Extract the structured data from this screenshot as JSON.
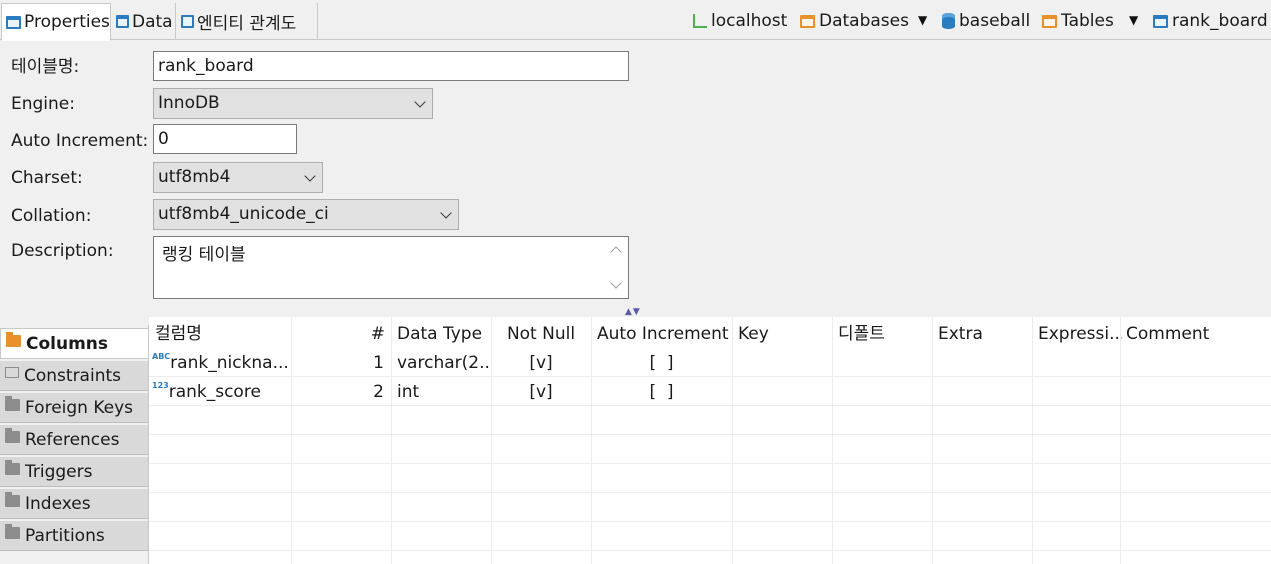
{
  "tabs": [
    {
      "label": "Properties"
    },
    {
      "label": "Data"
    },
    {
      "label": "엔티티 관계도"
    }
  ],
  "breadcrumb": {
    "host": "localhost",
    "databases": "Databases",
    "schema": "baseball",
    "tables": "Tables",
    "table": "rank_board"
  },
  "form": {
    "table_name_label": "테이블명:",
    "table_name_value": "rank_board",
    "engine_label": "Engine:",
    "engine_value": "InnoDB",
    "auto_increment_label": "Auto Increment:",
    "auto_increment_value": "0",
    "charset_label": "Charset:",
    "charset_value": "utf8mb4",
    "collation_label": "Collation:",
    "collation_value": "utf8mb4_unicode_ci",
    "description_label": "Description:",
    "description_value": "랭킹 테이블"
  },
  "sidebar": {
    "items": [
      {
        "label": "Columns"
      },
      {
        "label": "Constraints"
      },
      {
        "label": "Foreign Keys"
      },
      {
        "label": "References"
      },
      {
        "label": "Triggers"
      },
      {
        "label": "Indexes"
      },
      {
        "label": "Partitions"
      }
    ]
  },
  "table": {
    "headers": [
      "컬럼명",
      "#",
      "Data Type",
      "Not Null",
      "Auto Increment",
      "Key",
      "디폴트",
      "Extra",
      "Expressi...",
      "Comment"
    ],
    "rows": [
      {
        "type_icon": "ABC",
        "name": "rank_nickna...",
        "num": "1",
        "data_type": "varchar(2...",
        "not_null": "[v]",
        "auto_increment": "[  ]"
      },
      {
        "type_icon": "123",
        "name": "rank_score",
        "num": "2",
        "data_type": "int",
        "not_null": "[v]",
        "auto_increment": "[  ]"
      }
    ]
  },
  "colors": {
    "accent_blue": "#2a7bc0",
    "accent_orange": "#e8912c",
    "background": "#f0f0f0"
  }
}
